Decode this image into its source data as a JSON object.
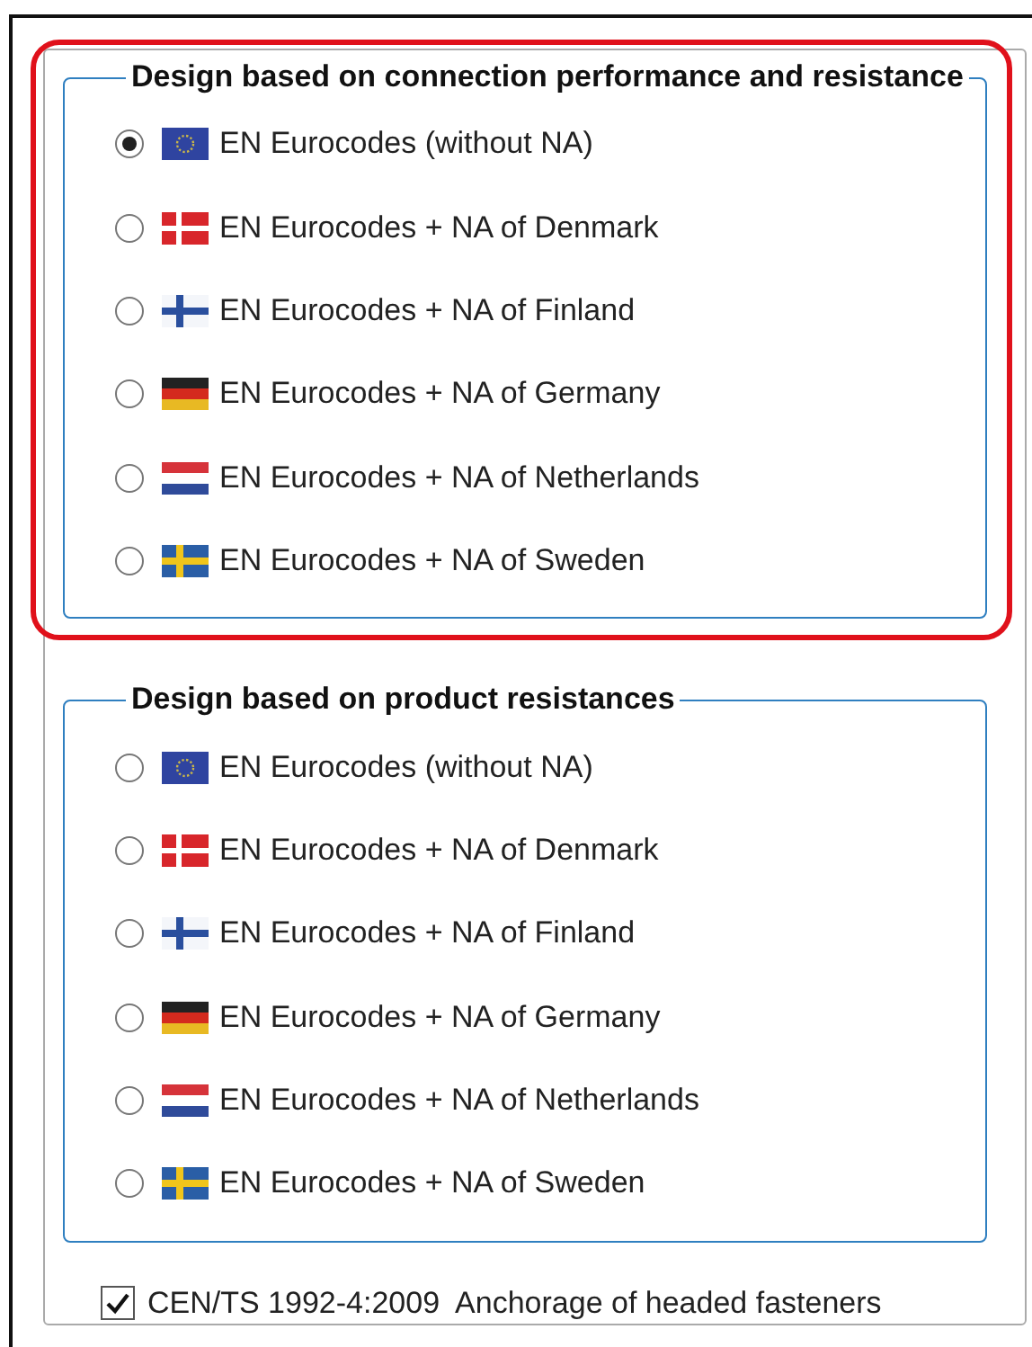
{
  "groups": [
    {
      "title": "Design based on connection performance and resistance",
      "highlighted": true,
      "options": [
        {
          "label": "EN Eurocodes (without NA)",
          "kind": "eu",
          "selected": true
        },
        {
          "label": "EN Eurocodes + NA of Denmark",
          "kind": "dk",
          "selected": false
        },
        {
          "label": "EN Eurocodes + NA of Finland",
          "kind": "fi",
          "selected": false
        },
        {
          "label": "EN Eurocodes + NA of Germany",
          "kind": "de",
          "selected": false
        },
        {
          "label": "EN Eurocodes + NA of Netherlands",
          "kind": "nl",
          "selected": false
        },
        {
          "label": "EN Eurocodes + NA of Sweden",
          "kind": "se",
          "selected": false
        }
      ]
    },
    {
      "title": "Design based on product resistances",
      "highlighted": false,
      "options": [
        {
          "label": "EN Eurocodes (without NA)",
          "kind": "eu",
          "selected": false
        },
        {
          "label": "EN Eurocodes + NA of Denmark",
          "kind": "dk",
          "selected": false
        },
        {
          "label": "EN Eurocodes + NA of Finland",
          "kind": "fi",
          "selected": false
        },
        {
          "label": "EN Eurocodes + NA of Germany",
          "kind": "de",
          "selected": false
        },
        {
          "label": "EN Eurocodes + NA of Netherlands",
          "kind": "nl",
          "selected": false
        },
        {
          "label": "EN Eurocodes + NA of Sweden",
          "kind": "se",
          "selected": false
        }
      ]
    }
  ],
  "checkbox": {
    "label": "CEN/TS 1992-4:2009  Anchorage of headed fasteners",
    "checked": true
  }
}
